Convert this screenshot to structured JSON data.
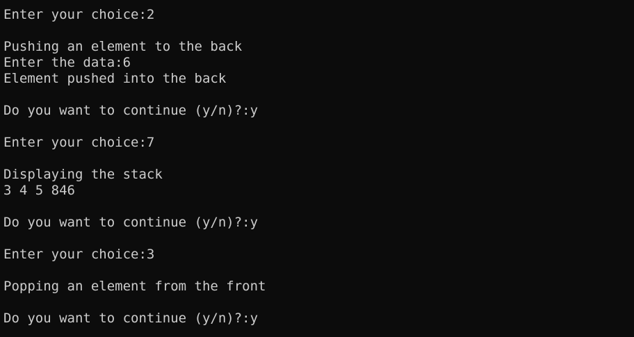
{
  "terminal": {
    "lines": [
      "Enter your choice:2",
      "",
      "Pushing an element to the back",
      "Enter the data:6",
      "Element pushed into the back",
      "",
      "Do you want to continue (y/n)?:y",
      "",
      "Enter your choice:7",
      "",
      "Displaying the stack",
      "3 4 5 846",
      "",
      "Do you want to continue (y/n)?:y",
      "",
      "Enter your choice:3",
      "",
      "Popping an element from the front",
      "",
      "Do you want to continue (y/n)?:y"
    ]
  },
  "colors": {
    "background": "#0c0c0c",
    "foreground": "#cccccc"
  }
}
